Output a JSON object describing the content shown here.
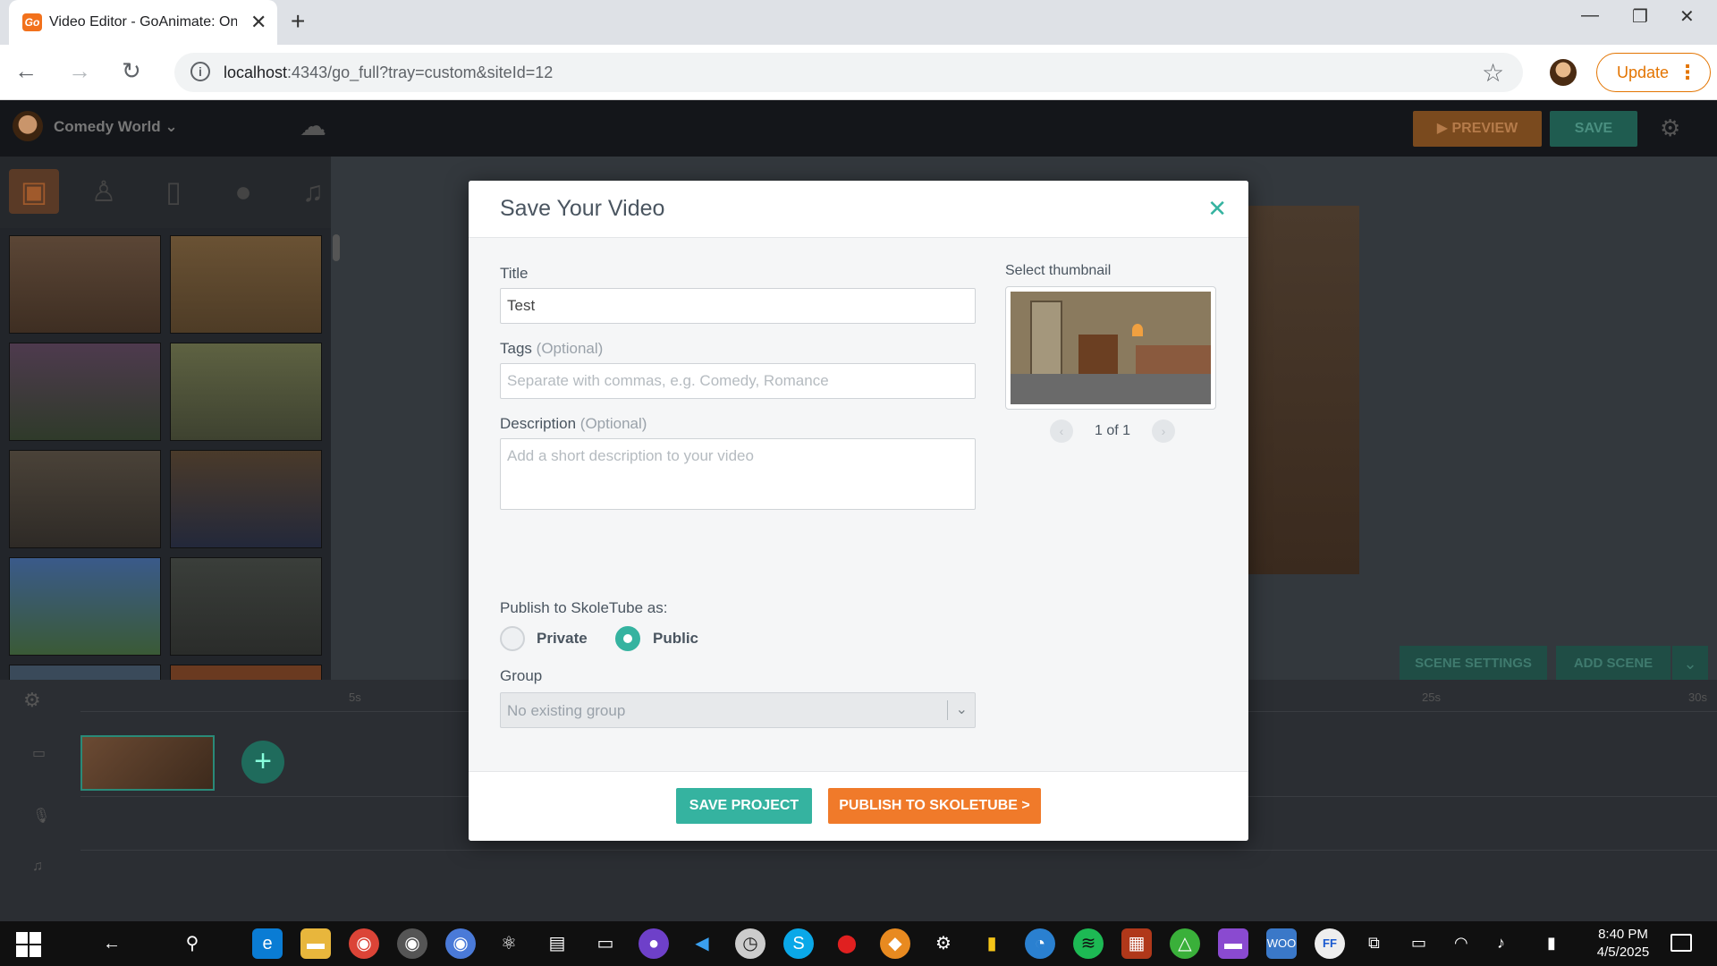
{
  "browser": {
    "tab_title": "Video Editor - GoAnimate: Onl",
    "favicon_text": "Go",
    "url_host": "localhost",
    "url_rest": ":4343/go_full?tray=custom&siteId=12",
    "update_label": "Update"
  },
  "app": {
    "world_name": "Comedy World",
    "preview_label": "PREVIEW",
    "save_label": "SAVE",
    "scene_settings_label": "SCENE SETTINGS",
    "add_scene_label": "ADD SCENE",
    "ruler": [
      "5s",
      "25s",
      "30s"
    ]
  },
  "modal": {
    "title": "Save Your Video",
    "title_label": "Title",
    "title_value": "Test",
    "tags_label": "Tags",
    "tags_optional": "(Optional)",
    "tags_placeholder": "Separate with commas, e.g. Comedy, Romance",
    "description_label": "Description",
    "description_optional": "(Optional)",
    "description_placeholder": "Add a short description to your video",
    "thumbnail_label": "Select thumbnail",
    "thumbnail_pager": "1 of 1",
    "publish_as_label": "Publish to SkoleTube as:",
    "private_label": "Private",
    "public_label": "Public",
    "selected_visibility": "Public",
    "group_label": "Group",
    "group_value": "No existing group",
    "save_project_label": "SAVE PROJECT",
    "publish_label": "PUBLISH TO SKOLETUBE >"
  },
  "taskbar": {
    "time": "8:40 PM",
    "date": "4/5/2025"
  },
  "colors": {
    "accent_teal": "#35b3a0",
    "accent_orange": "#f07a2a",
    "update_orange": "#e37400"
  }
}
